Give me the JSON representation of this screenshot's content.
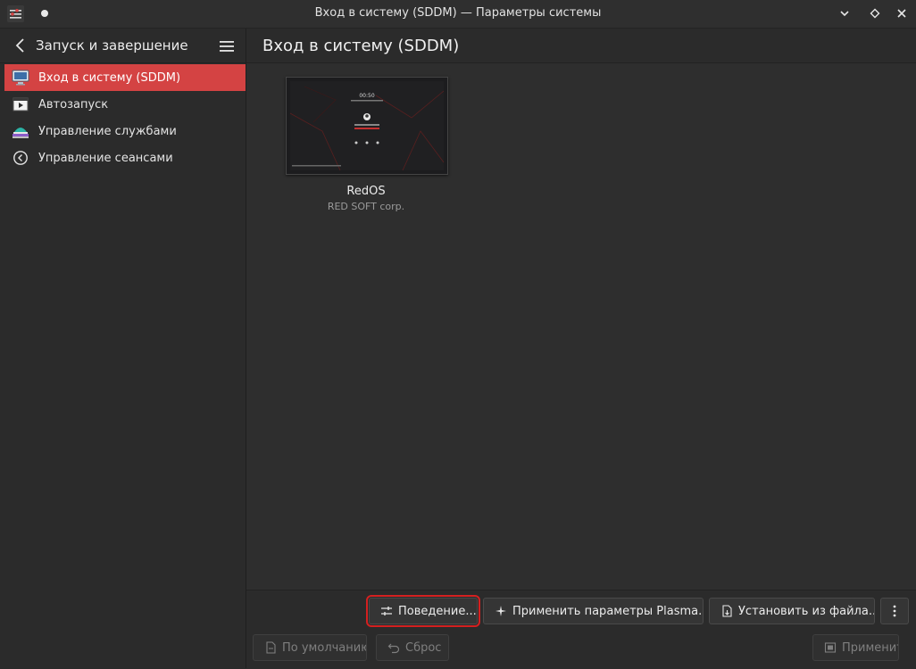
{
  "window": {
    "title": "Вход в систему (SDDM) — Параметры системы"
  },
  "sidebar": {
    "title": "Запуск и завершение",
    "items": [
      {
        "label": "Вход в систему (SDDM)",
        "icon": "monitor-icon",
        "active": true
      },
      {
        "label": "Автозапуск",
        "icon": "autostart-icon",
        "active": false
      },
      {
        "label": "Управление службами",
        "icon": "services-icon",
        "active": false
      },
      {
        "label": "Управление сеансами",
        "icon": "sessions-icon",
        "active": false
      }
    ]
  },
  "main": {
    "title": "Вход в систему (SDDM)",
    "themes": [
      {
        "name": "RedOS",
        "author": "RED SOFT corp.",
        "preview_clock": "00:50"
      }
    ]
  },
  "footer": {
    "behavior_label": "Поведение...",
    "apply_plasma_label": "Применить параметры Plasma...",
    "install_file_label": "Установить из файла...",
    "defaults_label": "По умолчанию",
    "reset_label": "Сброс",
    "apply_label": "Применить"
  },
  "colors": {
    "accent": "#d44343",
    "highlight_outline": "#d42020"
  }
}
